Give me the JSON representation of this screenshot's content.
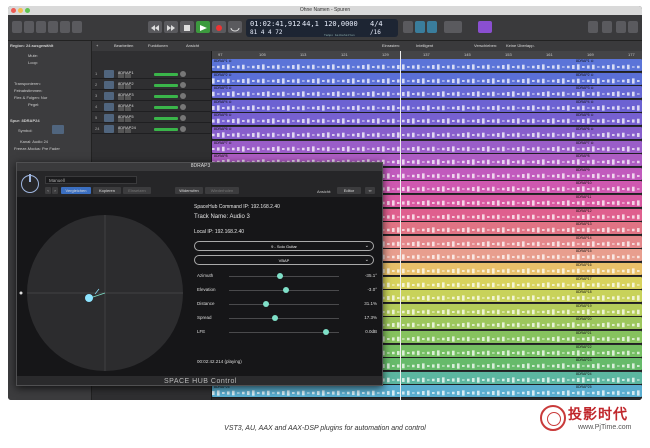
{
  "window": {
    "title": "Ohne Namen - Spuren"
  },
  "lcd": {
    "position": "01:02:41,912",
    "bars": "81  4  4   72",
    "tempo_int": "44,1",
    "tempo": "120,0000",
    "tempo_label": "Tempo beibehalten",
    "sig_top": "4/4",
    "sig_bottom": "/16"
  },
  "inspector": {
    "region_header": "Region: 24 ausgewählt",
    "rows": [
      "Mute:",
      "Loop:",
      "Transponieren:",
      "Feinabstimmen:",
      "Flex & Folgen: Nur",
      "Pegel:"
    ],
    "track_header": "Spur: 8DRAP24",
    "spatial_label": "Symbol:",
    "track_rows": [
      "Kanal: Audio 24",
      "Freeze-Modus: Pre Fader"
    ]
  },
  "track_header_bar": {
    "edit": "Bearbeiten",
    "functions": "Funktionen",
    "view": "Ansicht"
  },
  "tracks": [
    {
      "num": "1",
      "name": "8DRAP1"
    },
    {
      "num": "2",
      "name": "8DRAP2"
    },
    {
      "num": "3",
      "name": "8DRAP3"
    },
    {
      "num": "4",
      "name": "8DRAP4"
    },
    {
      "num": "5",
      "name": "8DRAP5"
    },
    {
      "num": "24",
      "name": "8DRAP24"
    }
  ],
  "arrange_bar": {
    "snap_label": "Einrasten:",
    "snap_value": "Intelligent",
    "drag_label": "Verschieben:",
    "drag_value": "Keine Überlapp."
  },
  "ruler": [
    "97",
    "105",
    "113",
    "121",
    "129",
    "137",
    "145",
    "153",
    "161",
    "169",
    "177"
  ],
  "region_labels": {
    "left": "8DRAP1",
    "right": "8DRAP1"
  },
  "lanes": [
    {
      "color": "#5b74d8",
      "label": "8DRAP1 ⊙",
      "label_right": "8DRAP1 ⊙"
    },
    {
      "color": "#5a6fd6",
      "label": "8DRAP2 ⊙",
      "label_right": "8DRAP2 ⊙"
    },
    {
      "color": "#6768d4",
      "label": "8DRAP3 ⊙",
      "label_right": "8DRAP3 ⊙"
    },
    {
      "color": "#6c62d2",
      "label": "8DRAP4 ⊙",
      "label_right": "8DRAP4 ⊙"
    },
    {
      "color": "#7660d0",
      "label": "8DRAP5 ⊙",
      "label_right": "8DRAP5 ⊙"
    },
    {
      "color": "#875ecc",
      "label": "8DRAP6 ⊙",
      "label_right": "8DRAP6 ⊙"
    },
    {
      "color": "#9a5dc8",
      "label": "8DRAP7 ⊙",
      "label_right": "8DRAP7 ⊙"
    },
    {
      "color": "#ad5cc2",
      "label": "8DRAP8",
      "label_right": "8DRAP8"
    },
    {
      "color": "#c15abd",
      "label": "8DRAP9",
      "label_right": "8DRAP9"
    },
    {
      "color": "#cf58b0",
      "label": "8DRAP10",
      "label_right": "8DRAP10"
    },
    {
      "color": "#d858a0",
      "label": "8DRAP11",
      "label_right": "8DRAP11"
    },
    {
      "color": "#df5f8e",
      "label": "8DRAP12",
      "label_right": "8DRAP12"
    },
    {
      "color": "#e07384",
      "label": "8DRAP13",
      "label_right": "8DRAP13"
    },
    {
      "color": "#e4878a",
      "label": "8DRAP14",
      "label_right": "8DRAP14"
    },
    {
      "color": "#e89e8e",
      "label": "8DRAP15",
      "label_right": "8DRAP15"
    },
    {
      "color": "#e8c06a",
      "label": "8DRAP16",
      "label_right": "8DRAP16"
    },
    {
      "color": "#d8d25c",
      "label": "8DRAP17",
      "label_right": "8DRAP17"
    },
    {
      "color": "#c8d25a",
      "label": "8DRAP18",
      "label_right": "8DRAP18"
    },
    {
      "color": "#b4cc5a",
      "label": "8DRAP19",
      "label_right": "8DRAP19"
    },
    {
      "color": "#9cc65c",
      "label": "8DRAP20",
      "label_right": "8DRAP20"
    },
    {
      "color": "#86c25e",
      "label": "8DRAP21",
      "label_right": "8DRAP21"
    },
    {
      "color": "#74be62",
      "label": "8DRAP22",
      "label_right": "8DRAP22"
    },
    {
      "color": "#66ba6a",
      "label": "8DRAP23",
      "label_right": "8DRAP23"
    },
    {
      "color": "#5cb6a0",
      "label": "8DRAP24",
      "label_right": "8DRAP24"
    },
    {
      "color": "#5aaed0",
      "label": "8DRAP25",
      "label_right": "8DRAP25"
    }
  ],
  "plugin": {
    "title": "8DRAP3",
    "preset": "Manuell",
    "buttons": [
      "Vergleichen",
      "Kopieren",
      "Einsetzen",
      "Widerrufen",
      "Wiederholen"
    ],
    "view_label": "Ansicht:",
    "view_value": "Editor",
    "command_ip": "SpaceHub Command IP: 192.168.2.40",
    "track_name": "Track Name: Audio 3",
    "local_ip": "Local IP: 192.168.2.40",
    "dropdown1": "9 - Solo Guitar",
    "dropdown2": "VBAP",
    "params": [
      {
        "label": "Azimuth",
        "value": "-35.1°",
        "pos": 0.46
      },
      {
        "label": "Elevation",
        "value": "-3.0°",
        "pos": 0.52
      },
      {
        "label": "Distance",
        "value": "31.1%",
        "pos": 0.34
      },
      {
        "label": "Spread",
        "value": "17.3%",
        "pos": 0.42
      },
      {
        "label": "LFE",
        "value": "0.0dB",
        "pos": 0.88
      }
    ],
    "time": "00:02:42.214  (playing)",
    "footer": "SPACE HUB Control"
  },
  "caption": "VST3, AU, AAX and AAX-DSP plugins for automation and control",
  "watermark": {
    "title": "投影时代",
    "url": "www.PjTime.com"
  }
}
